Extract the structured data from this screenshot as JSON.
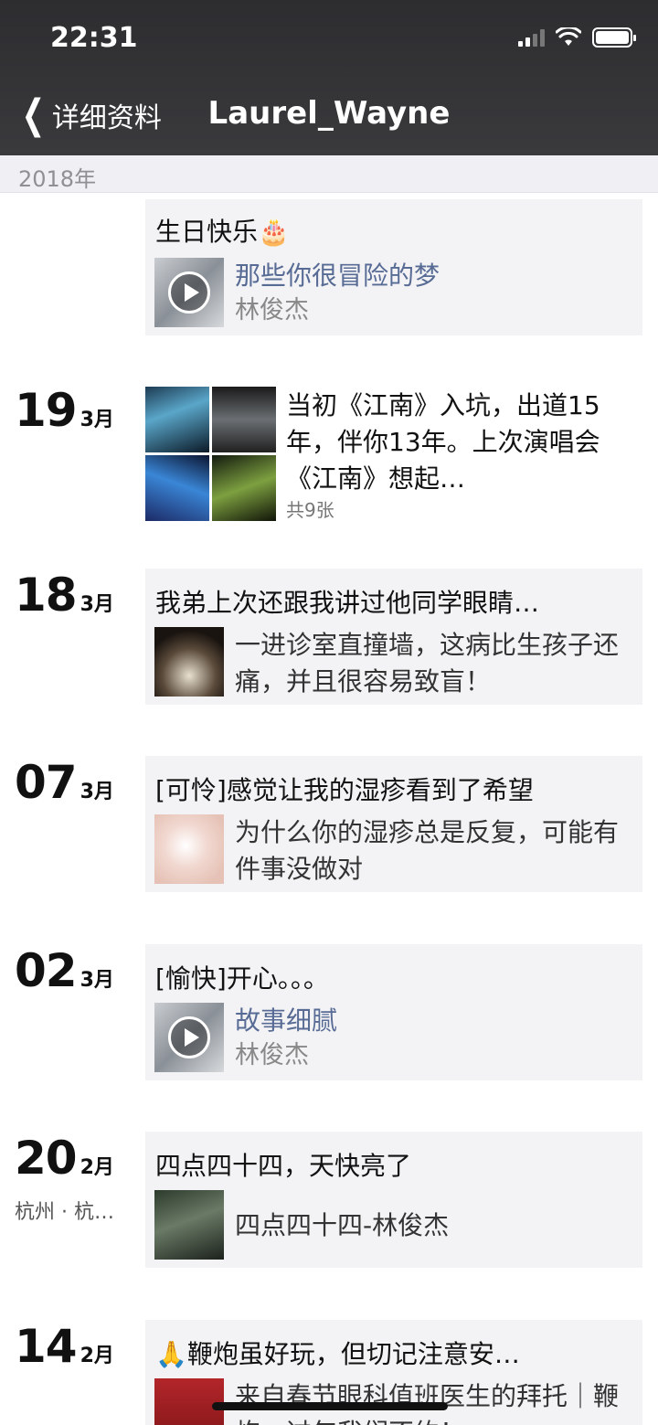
{
  "status": {
    "time": "22:31"
  },
  "nav": {
    "back_label": "详细资料",
    "title": "Laurel_Wayne"
  },
  "year_label": "2018年",
  "entries": [
    {
      "text": "生日快乐🎂",
      "share": {
        "title": "那些你很冒险的梦",
        "subtitle": "林俊杰",
        "type": "music"
      }
    },
    {
      "day": "19",
      "month": "3月",
      "text": "当初《江南》入坑，出道15年，伴你13年。上次演唱会《江南》想起…",
      "photo_count": "共9张"
    },
    {
      "day": "18",
      "month": "3月",
      "text": "我弟上次还跟我讲过他同学眼睛…",
      "share": {
        "title": "一进诊室直撞墙，这病比生孩子还痛，并且很容易致盲！",
        "type": "article"
      }
    },
    {
      "day": "07",
      "month": "3月",
      "text": "[可怜]感觉让我的湿疹看到了希望",
      "share": {
        "title": "为什么你的湿疹总是反复，可能有件事没做对",
        "type": "article"
      }
    },
    {
      "day": "02",
      "month": "3月",
      "text": "[愉快]开心。。。",
      "share": {
        "title": "故事细腻",
        "subtitle": "林俊杰",
        "type": "music"
      }
    },
    {
      "day": "20",
      "month": "2月",
      "location": "杭州 · 杭…",
      "text": "四点四十四，天快亮了",
      "share": {
        "title": "四点四十四-林俊杰",
        "type": "article"
      }
    },
    {
      "day": "14",
      "month": "2月",
      "text": "🙏鞭炮虽好玩，但切记注意安…",
      "share": {
        "title": "来自春节眼科值班医生的拜托｜鞭炮，过年我们不约！",
        "type": "article"
      }
    }
  ]
}
